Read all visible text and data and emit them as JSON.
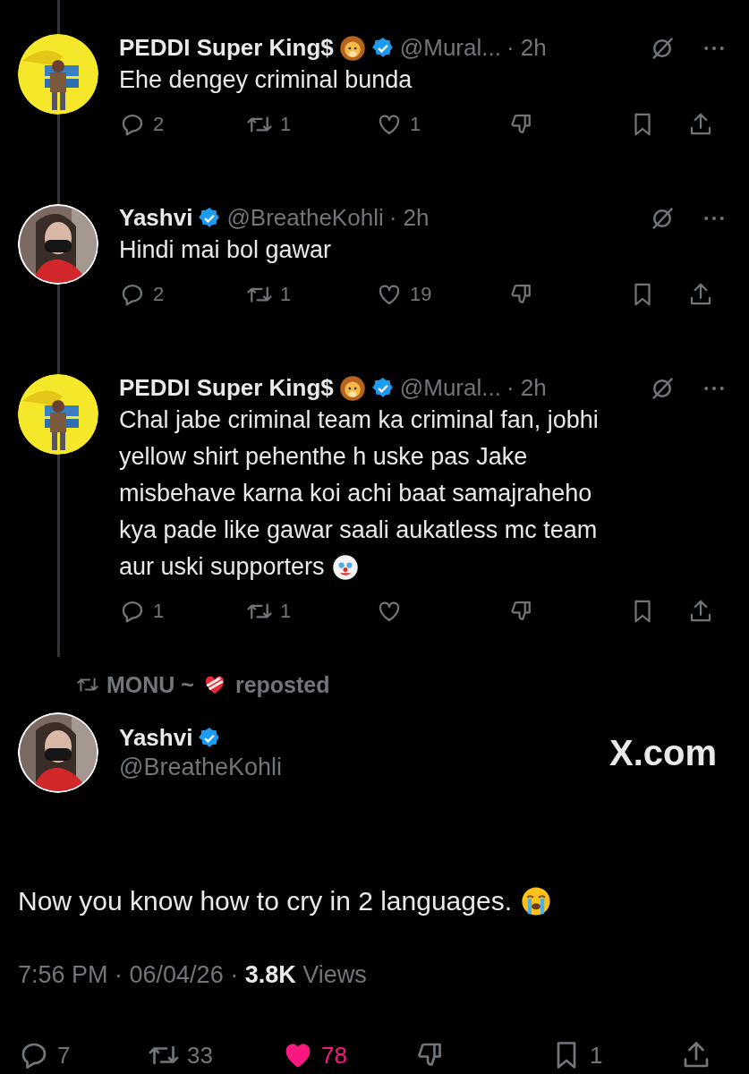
{
  "thread": [
    {
      "author": "PEDDI Super King$",
      "handle": "@Mural...",
      "time": "· 2h",
      "lines": [
        "Ehe dengey criminal bunda"
      ],
      "replies": "2",
      "reposts": "1",
      "likes": "1",
      "liked": false
    },
    {
      "author": "Yashvi",
      "handle": "@BreatheKohli",
      "time": "· 2h",
      "lines": [
        "Hindi mai bol gawar"
      ],
      "replies": "2",
      "reposts": "1",
      "likes": "19",
      "liked": false
    },
    {
      "author": "PEDDI Super King$",
      "handle": "@Mural...",
      "time": "· 2h",
      "lines": [
        "Chal jabe criminal team ka criminal fan, jobhi",
        "yellow shirt pehenthe h uske pas Jake",
        "misbehave karna koi achi baat samajraheho",
        "kya pade like gawar saali aukatless mc team",
        "aur uski supporters"
      ],
      "clown_emoji": true,
      "replies": "1",
      "reposts": "1",
      "liked": false
    }
  ],
  "repost_banner": {
    "user": "MONU ~",
    "label": "reposted"
  },
  "main": {
    "author": "Yashvi",
    "handle": "@BreatheKohli",
    "site": "X.com",
    "text": "Now you know how to cry in 2 languages.",
    "time": "7:56 PM · 06/04/26 ·",
    "views_count": "3.8K",
    "views_label": "Views",
    "replies": "7",
    "reposts": "33",
    "likes": "78",
    "liked": true,
    "bookmarks": "1"
  }
}
